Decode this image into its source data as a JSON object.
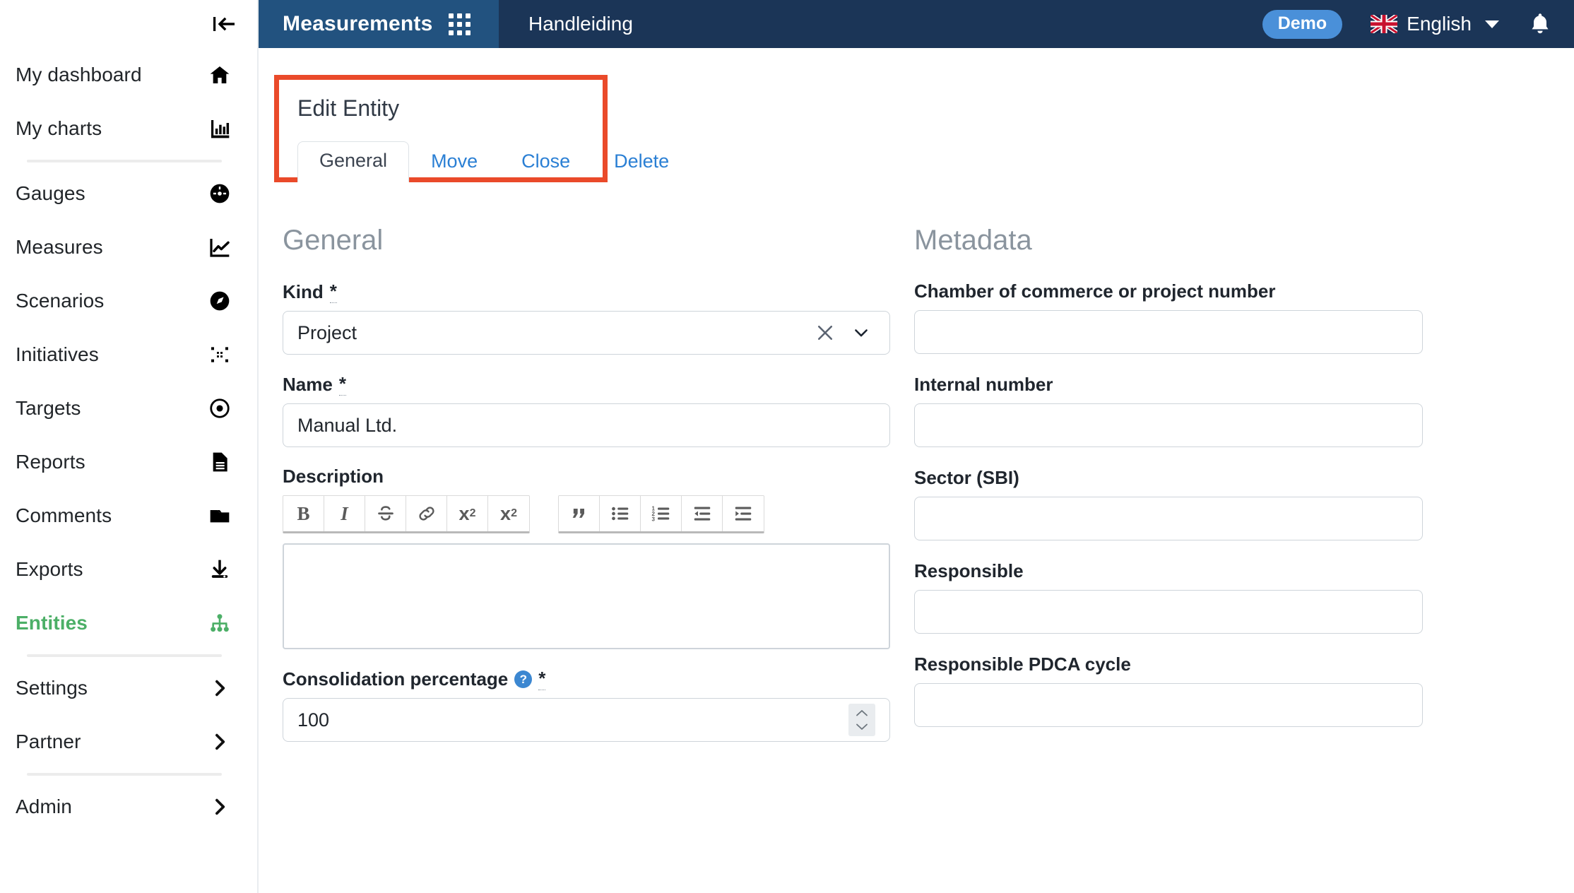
{
  "sidebar": {
    "collapse_icon": "collapse-left-icon",
    "items": [
      {
        "label": "My dashboard",
        "icon": "home-icon",
        "active": false,
        "divider_after": false
      },
      {
        "label": "My charts",
        "icon": "bar-chart-icon",
        "active": false,
        "divider_after": true
      },
      {
        "label": "Gauges",
        "icon": "gauge-icon",
        "active": false,
        "divider_after": false
      },
      {
        "label": "Measures",
        "icon": "line-chart-icon",
        "active": false,
        "divider_after": false
      },
      {
        "label": "Scenarios",
        "icon": "compass-icon",
        "active": false,
        "divider_after": false
      },
      {
        "label": "Initiatives",
        "icon": "compress-icon",
        "active": false,
        "divider_after": false
      },
      {
        "label": "Targets",
        "icon": "target-dot-icon",
        "active": false,
        "divider_after": false
      },
      {
        "label": "Reports",
        "icon": "document-icon",
        "active": false,
        "divider_after": false
      },
      {
        "label": "Comments",
        "icon": "folder-open-icon",
        "active": false,
        "divider_after": false
      },
      {
        "label": "Exports",
        "icon": "download-icon",
        "active": false,
        "divider_after": false
      },
      {
        "label": "Entities",
        "icon": "sitemap-icon",
        "active": true,
        "divider_after": true
      },
      {
        "label": "Settings",
        "icon": "chevron-right-icon",
        "active": false,
        "divider_after": false
      },
      {
        "label": "Partner",
        "icon": "chevron-right-icon",
        "active": false,
        "divider_after": true
      },
      {
        "label": "Admin",
        "icon": "chevron-right-icon",
        "active": false,
        "divider_after": false
      }
    ]
  },
  "topbar": {
    "brand": "Measurements",
    "apps_icon": "apps-grid-icon",
    "nav": [
      {
        "label": "Handleiding"
      }
    ],
    "demo_badge": "Demo",
    "language": "English",
    "language_flag": "uk-flag-icon",
    "language_caret": "chevron-down-icon",
    "bell_icon": "bell-icon",
    "brand_bg": "#22527f",
    "bar_bg": "#1b3557",
    "demo_bg": "#4a90d9"
  },
  "edit_panel": {
    "title": "Edit Entity",
    "highlight_color": "#ea4a2a",
    "tabs": [
      {
        "label": "General",
        "active": true
      },
      {
        "label": "Move",
        "active": false
      },
      {
        "label": "Close",
        "active": false
      },
      {
        "label": "Delete",
        "active": false
      }
    ]
  },
  "general": {
    "heading": "General",
    "kind": {
      "label": "Kind",
      "required": "*",
      "value": "Project",
      "clear_icon": "close-x-icon",
      "chevron_icon": "chevron-down-icon"
    },
    "name": {
      "label": "Name",
      "required": "*",
      "value": "Manual Ltd."
    },
    "description": {
      "label": "Description",
      "value": "",
      "toolbar_group_1": [
        {
          "label": "B",
          "icon": "bold-icon"
        },
        {
          "label": "I",
          "icon": "italic-icon"
        },
        {
          "label": "S",
          "icon": "strikethrough-icon"
        },
        {
          "label": "",
          "icon": "link-icon"
        },
        {
          "label": "x2",
          "icon": "superscript-icon"
        },
        {
          "label": "x2",
          "icon": "subscript-icon"
        }
      ],
      "toolbar_group_2": [
        {
          "label": "",
          "icon": "blockquote-icon"
        },
        {
          "label": "",
          "icon": "bulleted-list-icon"
        },
        {
          "label": "",
          "icon": "numbered-list-icon"
        },
        {
          "label": "",
          "icon": "outdent-icon"
        },
        {
          "label": "",
          "icon": "indent-icon"
        }
      ]
    },
    "consolidation": {
      "label": "Consolidation percentage",
      "help_icon": "help-question-icon",
      "help_glyph": "?",
      "required": "*",
      "value": "100",
      "spinner_icon": "number-spinner-icon"
    }
  },
  "metadata": {
    "heading": "Metadata",
    "fields": [
      {
        "label": "Chamber of commerce or project number",
        "value": ""
      },
      {
        "label": "Internal number",
        "value": ""
      },
      {
        "label": "Sector (SBI)",
        "value": ""
      },
      {
        "label": "Responsible",
        "value": ""
      },
      {
        "label": "Responsible PDCA cycle",
        "value": ""
      }
    ]
  }
}
